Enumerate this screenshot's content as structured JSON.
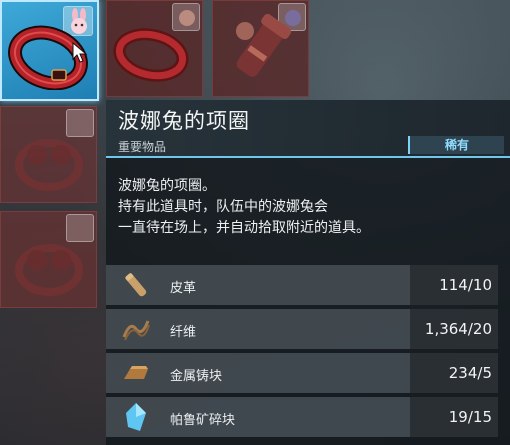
{
  "item": {
    "name": "波娜兔的项圈",
    "category": "重要物品",
    "rarity": "稀有",
    "description": [
      "波娜兔的项圈。",
      "持有此道具时，队伍中的波娜兔会",
      "一直待在场上，并自动拾取附近的道具。"
    ]
  },
  "materials": [
    {
      "name": "皮革",
      "count": "114/10",
      "icon": "leather-icon"
    },
    {
      "name": "纤维",
      "count": "1,364/20",
      "icon": "fiber-icon"
    },
    {
      "name": "金属铸块",
      "count": "234/5",
      "icon": "ingot-icon"
    },
    {
      "name": "帕鲁矿碎块",
      "count": "19/15",
      "icon": "pal-crystal-icon"
    }
  ],
  "grid": [
    {
      "icon": "red-collar-icon",
      "state": "selected"
    },
    {
      "icon": "red-collar-icon",
      "state": "normal"
    },
    {
      "icon": "cannon-launcher-icon",
      "state": "normal"
    },
    {
      "icon": "goggles-accessory-icon",
      "state": "faded"
    },
    {
      "icon": "goggles-accessory-icon",
      "state": "faded"
    }
  ],
  "colors": {
    "accent": "#6fc8ec",
    "selected_slot": "#2e95c8",
    "slot_red": "#5a2626",
    "rarity_text": "#8fdcff"
  }
}
